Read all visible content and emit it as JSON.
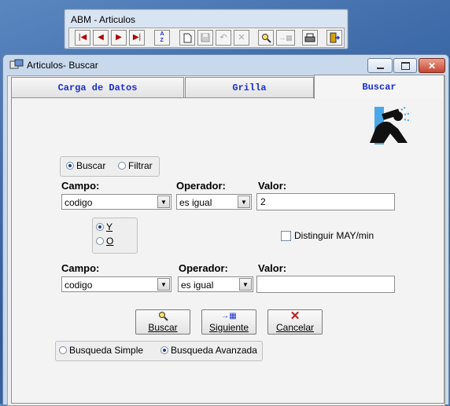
{
  "toolbar_window": {
    "title": "ABM - Articulos",
    "buttons": [
      {
        "name": "first-record-button",
        "glyph": "⏮"
      },
      {
        "name": "prev-record-button",
        "glyph": "◀"
      },
      {
        "name": "next-record-button",
        "glyph": "▶"
      },
      {
        "name": "last-record-button",
        "glyph": "⏭"
      },
      {
        "name": "sort-az-button",
        "glyph": "A↓"
      },
      {
        "name": "new-button",
        "glyph": "🗋"
      },
      {
        "name": "save-button",
        "glyph": "💾"
      },
      {
        "name": "undo-button",
        "glyph": "↶"
      },
      {
        "name": "delete-button",
        "glyph": "✕"
      },
      {
        "name": "find-button",
        "glyph": "🔍"
      },
      {
        "name": "goto-grid-button",
        "glyph": "▸▦"
      },
      {
        "name": "print-button",
        "glyph": "🖶"
      },
      {
        "name": "exit-button",
        "glyph": "⇥"
      }
    ]
  },
  "main_window": {
    "title": "Articulos- Buscar",
    "tabs": {
      "carga": "Carga de Datos",
      "grilla": "Grilla",
      "buscar": "Buscar"
    },
    "mode": {
      "buscar": "Buscar",
      "filtrar": "Filtrar",
      "selected": "Buscar"
    },
    "row1": {
      "campo_label": "Campo:",
      "campo_value": "codigo",
      "operador_label": "Operador:",
      "operador_value": "es igual",
      "valor_label": "Valor:",
      "valor_value": "2"
    },
    "logic": {
      "y": "Y",
      "o": "O",
      "selected": "Y"
    },
    "case_check": {
      "label": "Distinguir MAY/min",
      "checked": false
    },
    "row2": {
      "campo_label": "Campo:",
      "campo_value": "codigo",
      "operador_label": "Operador:",
      "operador_value": "es igual",
      "valor_label": "Valor:",
      "valor_value": ""
    },
    "buttons": {
      "buscar": "Buscar",
      "siguiente": "Siguiente",
      "cancelar": "Cancelar"
    },
    "search_type": {
      "simple": "Busqueda Simple",
      "avanzada": "Busqueda Avanzada",
      "selected": "Busqueda Avanzada"
    }
  },
  "colors": {
    "tab_text": "#1a2fd0",
    "cancel_icon": "#c01818",
    "desktop": "#3d6aa8"
  }
}
